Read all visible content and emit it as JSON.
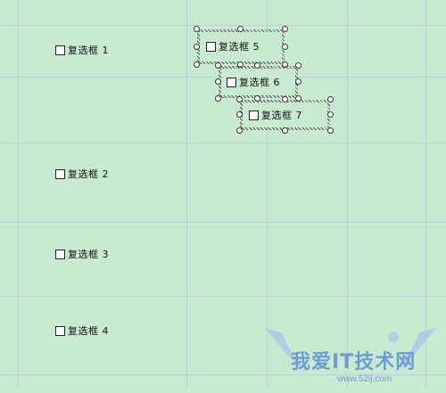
{
  "checkboxes": [
    {
      "label": "复选框 1",
      "checked": false
    },
    {
      "label": "复选框 2",
      "checked": false
    },
    {
      "label": "复选框 3",
      "checked": false
    },
    {
      "label": "复选框 4",
      "checked": false
    },
    {
      "label": "复选框 5",
      "checked": false,
      "selected": true
    },
    {
      "label": "复选框 6",
      "checked": false,
      "selected": true
    },
    {
      "label": "复选框 7",
      "checked": false,
      "selected": true
    }
  ],
  "watermark": {
    "text": "我爱IT技术网",
    "url": "www.52ij.com"
  },
  "colors": {
    "sheet_bg": "#c8ead0",
    "gridline": "#bfcde0",
    "watermark": "#6f9bd3"
  }
}
